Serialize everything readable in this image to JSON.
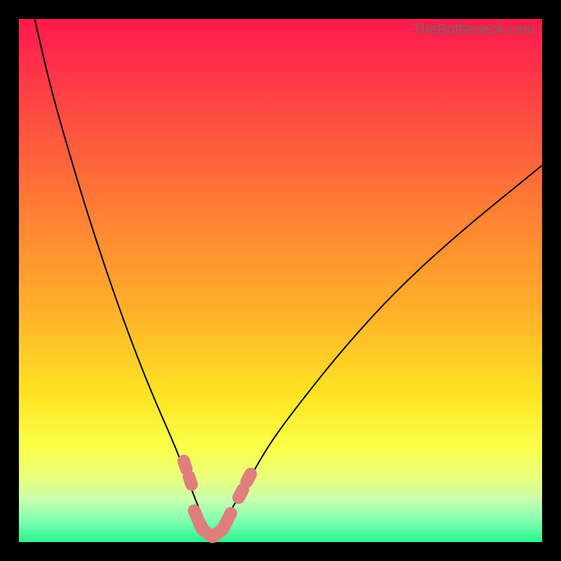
{
  "watermark": "TheBottleneck.com",
  "colors": {
    "background_frame": "#000000",
    "gradient_top": "#ff1a4d",
    "gradient_bottom": "#28f58d",
    "curve": "#000000",
    "highlight": "#e07d7d"
  },
  "chart_data": {
    "type": "line",
    "title": "",
    "xlabel": "",
    "ylabel": "",
    "xlim": [
      0,
      100
    ],
    "ylim": [
      0,
      100
    ],
    "grid": false,
    "legend": false,
    "note": "No axis ticks or numeric labels are visible; x/y values are estimated from pixel positions on a 0–100 normalized scale. The curve is a V-shaped bottleneck profile with minimum near x≈37. Pink segments highlight points near the curve bottom.",
    "series": [
      {
        "name": "bottleneck-curve",
        "x": [
          3,
          6,
          10,
          14,
          18,
          22,
          26,
          30,
          33,
          35,
          37,
          39,
          41,
          44,
          48,
          54,
          62,
          72,
          84,
          100
        ],
        "y": [
          100,
          87,
          73,
          60,
          48,
          37,
          27,
          18,
          10,
          5,
          1,
          3,
          7,
          12,
          19,
          27,
          37,
          48,
          59,
          72
        ]
      }
    ],
    "highlight_segments": [
      {
        "name": "left-upper-dash",
        "x": [
          31.5,
          32.0
        ],
        "y": [
          15.5,
          14.0
        ]
      },
      {
        "name": "left-lower-dash",
        "x": [
          32.5,
          33.0
        ],
        "y": [
          12.5,
          11.0
        ]
      },
      {
        "name": "bottom-run",
        "x": [
          33.5,
          35.0,
          37.0,
          39.0,
          40.5
        ],
        "y": [
          6.0,
          2.5,
          1.0,
          2.5,
          5.5
        ]
      },
      {
        "name": "right-lower-dash",
        "x": [
          42.0,
          42.8
        ],
        "y": [
          8.5,
          10.0
        ]
      },
      {
        "name": "right-upper-dash",
        "x": [
          43.5,
          44.3
        ],
        "y": [
          11.5,
          13.0
        ]
      }
    ]
  }
}
